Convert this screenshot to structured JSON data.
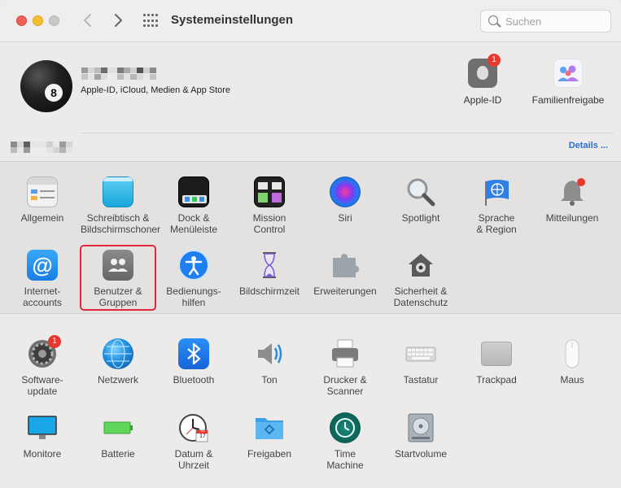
{
  "window": {
    "title": "Systemeinstellungen"
  },
  "search": {
    "placeholder": "Suchen"
  },
  "account": {
    "subtitle": "Apple-ID, iCloud, Medien & App Store",
    "details_link": "Details ..."
  },
  "top_items": [
    {
      "label": "Apple-ID",
      "icon": "apple-logo-icon",
      "badge": "1"
    },
    {
      "label": "Familienfreigabe",
      "icon": "family-sharing-icon"
    }
  ],
  "section1": [
    {
      "label": "Allgemein",
      "icon": "general-window-icon"
    },
    {
      "label": "Schreibtisch &\nBildschirmschoner",
      "icon": "desktop-icon"
    },
    {
      "label": "Dock &\nMenüleiste",
      "icon": "dock-icon"
    },
    {
      "label": "Mission\nControl",
      "icon": "mission-control-icon"
    },
    {
      "label": "Siri",
      "icon": "siri-icon"
    },
    {
      "label": "Spotlight",
      "icon": "magnifier-icon"
    },
    {
      "label": "Sprache\n& Region",
      "icon": "flag-globe-icon"
    },
    {
      "label": "Mitteilungen",
      "icon": "bell-icon"
    },
    {
      "label": "Internet-\naccounts",
      "icon": "at-sign-icon"
    },
    {
      "label": "Benutzer &\nGruppen",
      "icon": "users-icon"
    },
    {
      "label": "Bedienungs-\nhilfen",
      "icon": "accessibility-icon"
    },
    {
      "label": "Bildschirmzeit",
      "icon": "hourglass-icon"
    },
    {
      "label": "Erweiterungen",
      "icon": "puzzle-icon"
    },
    {
      "label": "Sicherheit &\nDatenschutz",
      "icon": "house-lock-icon"
    }
  ],
  "section2": [
    {
      "label": "Software-\nupdate",
      "icon": "gear-icon",
      "badge": "1"
    },
    {
      "label": "Netzwerk",
      "icon": "globe-network-icon"
    },
    {
      "label": "Bluetooth",
      "icon": "bluetooth-icon"
    },
    {
      "label": "Ton",
      "icon": "speaker-icon"
    },
    {
      "label": "Drucker &\nScanner",
      "icon": "printer-icon"
    },
    {
      "label": "Tastatur",
      "icon": "keyboard-icon"
    },
    {
      "label": "Trackpad",
      "icon": "trackpad-icon"
    },
    {
      "label": "Maus",
      "icon": "mouse-icon"
    },
    {
      "label": "Monitore",
      "icon": "monitor-icon"
    },
    {
      "label": "Batterie",
      "icon": "battery-icon"
    },
    {
      "label": "Datum &\nUhrzeit",
      "icon": "clock-icon",
      "calendar_label": "JUL",
      "calendar_day": "17"
    },
    {
      "label": "Freigaben",
      "icon": "shared-folder-icon"
    },
    {
      "label": "Time\nMachine",
      "icon": "time-machine-icon"
    },
    {
      "label": "Startvolume",
      "icon": "hard-drive-icon"
    }
  ]
}
